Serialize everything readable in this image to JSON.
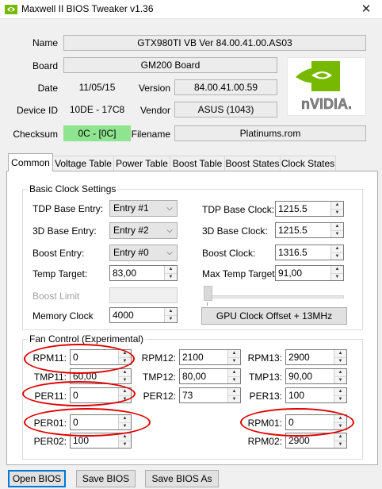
{
  "window": {
    "title": "Maxwell II BIOS Tweaker v1.36",
    "close_glyph": "✕"
  },
  "header": {
    "name_label": "Name",
    "name_value": "GTX980TI VB Ver 84.00.41.00.AS03",
    "board_label": "Board",
    "board_value": "GM200 Board",
    "date_label": "Date",
    "date_value": "11/05/15",
    "version_label": "Version",
    "version_value": "84.00.41.00.59",
    "device_id_label": "Device ID",
    "device_id_value": "10DE - 17C8",
    "vendor_label": "Vendor",
    "vendor_value": "ASUS (1043)",
    "checksum_label": "Checksum",
    "checksum_value": "0C - [0C]",
    "filename_label": "Filename",
    "filename_value": "Platinums.rom",
    "logo_text": "nVIDIA."
  },
  "tabs": [
    {
      "label": "Common",
      "active": true
    },
    {
      "label": "Voltage Table"
    },
    {
      "label": "Power Table"
    },
    {
      "label": "Boost Table"
    },
    {
      "label": "Boost States"
    },
    {
      "label": "Clock States"
    }
  ],
  "basic": {
    "title": "Basic Clock Settings",
    "tdp_base_entry_label": "TDP Base Entry:",
    "tdp_base_entry_value": "Entry #1",
    "base_3d_entry_label": "3D Base Entry:",
    "base_3d_entry_value": "Entry #2",
    "boost_entry_label": "Boost Entry:",
    "boost_entry_value": "Entry #0",
    "temp_target_label": "Temp Target:",
    "temp_target_value": "83,00",
    "boost_limit_label": "Boost Limit",
    "memory_clock_label": "Memory Clock",
    "memory_clock_value": "4000",
    "tdp_base_clock_label": "TDP Base Clock:",
    "tdp_base_clock_value": "1215.5",
    "base_3d_clock_label": "3D Base Clock:",
    "base_3d_clock_value": "1215.5",
    "boost_clock_label": "Boost Clock:",
    "boost_clock_value": "1316.5",
    "max_temp_target_label": "Max Temp Target:",
    "max_temp_target_value": "91,00",
    "gpu_offset_button": "GPU Clock Offset + 13MHz"
  },
  "fan": {
    "title": "Fan Control (Experimental)",
    "rpm11_label": "RPM11:",
    "rpm11_value": "0",
    "tmp11_label": "TMP11:",
    "tmp11_value": "60,00",
    "per11_label": "PER11:",
    "per11_value": "0",
    "per01_label": "PER01:",
    "per01_value": "0",
    "per02_label": "PER02:",
    "per02_value": "100",
    "rpm12_label": "RPM12:",
    "rpm12_value": "2100",
    "tmp12_label": "TMP12:",
    "tmp12_value": "80,00",
    "per12_label": "PER12:",
    "per12_value": "73",
    "rpm13_label": "RPM13:",
    "rpm13_value": "2900",
    "tmp13_label": "TMP13:",
    "tmp13_value": "90,00",
    "per13_label": "PER13:",
    "per13_value": "100",
    "rpm01_label": "RPM01:",
    "rpm01_value": "0",
    "rpm02_label": "RPM02:",
    "rpm02_value": "2900"
  },
  "footer": {
    "open_bios": "Open BIOS",
    "save_bios": "Save BIOS",
    "save_bios_as": "Save BIOS As"
  },
  "spinner_glyphs": {
    "up": "▲",
    "down": "▼",
    "combo": "⌵"
  },
  "colors": {
    "checksum_ok": "#8fe58f",
    "annotation_red": "#e00000",
    "nvidia_green": "#76b900"
  }
}
